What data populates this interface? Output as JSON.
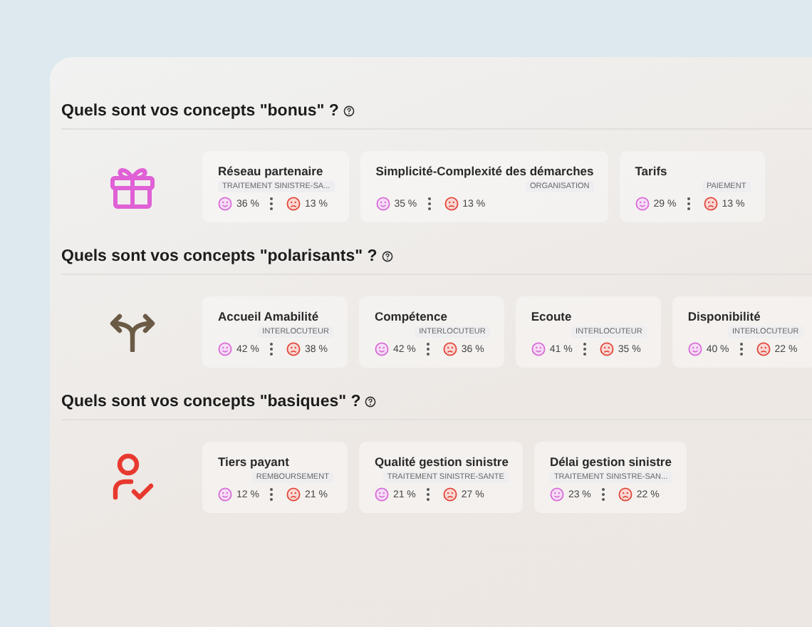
{
  "sections": [
    {
      "title": "Quels sont vos concepts \"bonus\" ?",
      "kind": "gift",
      "cards": [
        {
          "title": "Réseau partenaire",
          "tag": "TRAITEMENT SINISTRE-SA...",
          "positive": "36 %",
          "negative": "13 %"
        },
        {
          "title": "Simplicité-Complexité des démarches",
          "tag": "ORGANISATION",
          "positive": "35 %",
          "negative": "13 %"
        },
        {
          "title": "Tarifs",
          "tag": "PAIEMENT",
          "positive": "29 %",
          "negative": "13 %"
        }
      ]
    },
    {
      "title": "Quels sont vos concepts \"polarisants\" ?",
      "kind": "split",
      "cards": [
        {
          "title": "Accueil Amabilité",
          "tag": "INTERLOCUTEUR",
          "positive": "42 %",
          "negative": "38 %"
        },
        {
          "title": "Compétence",
          "tag": "INTERLOCUTEUR",
          "positive": "42 %",
          "negative": "36 %"
        },
        {
          "title": "Ecoute",
          "tag": "INTERLOCUTEUR",
          "positive": "41 %",
          "negative": "35 %"
        },
        {
          "title": "Disponibilité",
          "tag": "INTERLOCUTEUR",
          "positive": "40 %",
          "negative": "22 %"
        }
      ]
    },
    {
      "title": "Quels sont vos concepts \"basiques\" ?",
      "kind": "user-check",
      "cards": [
        {
          "title": "Tiers payant",
          "tag": "REMBOURSEMENT",
          "positive": "12 %",
          "negative": "21 %"
        },
        {
          "title": "Qualité gestion sinistre",
          "tag": "TRAITEMENT SINISTRE-SANTE",
          "positive": "21 %",
          "negative": "27 %"
        },
        {
          "title": "Délai gestion sinistre",
          "tag": "TRAITEMENT SINISTRE-SAN...",
          "positive": "23 %",
          "negative": "22 %"
        }
      ]
    }
  ]
}
